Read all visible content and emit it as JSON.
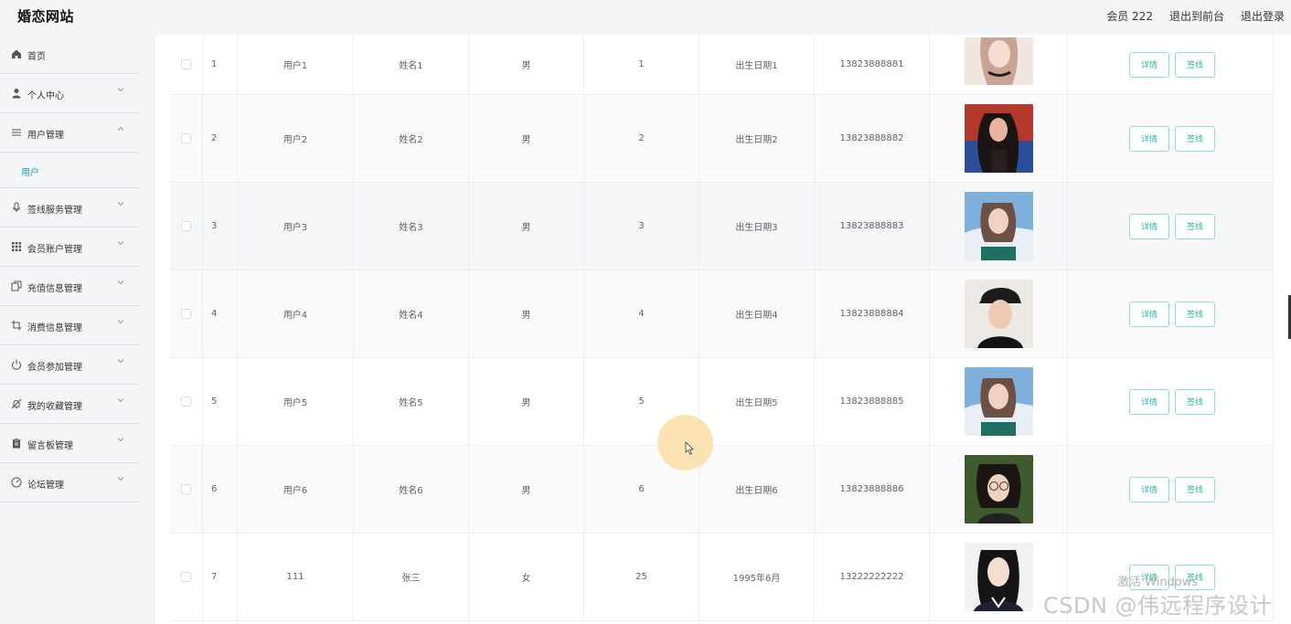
{
  "app": {
    "brand": "婚恋网站"
  },
  "header": {
    "member_label": "会员 222",
    "to_front_label": "退出到前台",
    "logout_label": "退出登录"
  },
  "sidebar": {
    "items": [
      {
        "label": "首页",
        "icon": "home-icon"
      },
      {
        "label": "个人中心",
        "icon": "user-icon"
      },
      {
        "label": "用户管理",
        "icon": "list-icon",
        "expanded": true,
        "children": [
          "用户"
        ]
      },
      {
        "label": "签线服务管理",
        "icon": "mic-icon"
      },
      {
        "label": "会员账户管理",
        "icon": "grid-icon"
      },
      {
        "label": "充值信息管理",
        "icon": "copy-icon"
      },
      {
        "label": "消费信息管理",
        "icon": "crop-icon"
      },
      {
        "label": "会员参加管理",
        "icon": "power-icon"
      },
      {
        "label": "我的收藏管理",
        "icon": "bell-off-icon"
      },
      {
        "label": "留言板管理",
        "icon": "clipboard-icon"
      },
      {
        "label": "论坛管理",
        "icon": "gauge-icon"
      }
    ]
  },
  "table": {
    "rows": [
      {
        "index": "1",
        "username": "用户1",
        "name": "姓名1",
        "gender": "男",
        "age": "1",
        "birth": "出生日期1",
        "phone": "13823888881"
      },
      {
        "index": "2",
        "username": "用户2",
        "name": "姓名2",
        "gender": "男",
        "age": "2",
        "birth": "出生日期2",
        "phone": "13823888882"
      },
      {
        "index": "3",
        "username": "用户3",
        "name": "姓名3",
        "gender": "男",
        "age": "3",
        "birth": "出生日期3",
        "phone": "13823888883"
      },
      {
        "index": "4",
        "username": "用户4",
        "name": "姓名4",
        "gender": "男",
        "age": "4",
        "birth": "出生日期4",
        "phone": "13823888884"
      },
      {
        "index": "5",
        "username": "用户5",
        "name": "姓名5",
        "gender": "男",
        "age": "5",
        "birth": "出生日期5",
        "phone": "13823888885"
      },
      {
        "index": "6",
        "username": "用户6",
        "name": "姓名6",
        "gender": "男",
        "age": "6",
        "birth": "出生日期6",
        "phone": "13823888886"
      },
      {
        "index": "7",
        "username": "111",
        "name": "张三",
        "gender": "女",
        "age": "25",
        "birth": "1995年6月",
        "phone": "13222222222"
      }
    ],
    "detail_label": "详情",
    "sign_label": "签线"
  },
  "watermarks": {
    "activate": "激活 Windows",
    "csdn": "CSDN @伟远程序设计"
  },
  "colors": {
    "accent": "#1aa3c9",
    "button_text": "#2cb8a1",
    "button_border": "#8fe0c4"
  }
}
